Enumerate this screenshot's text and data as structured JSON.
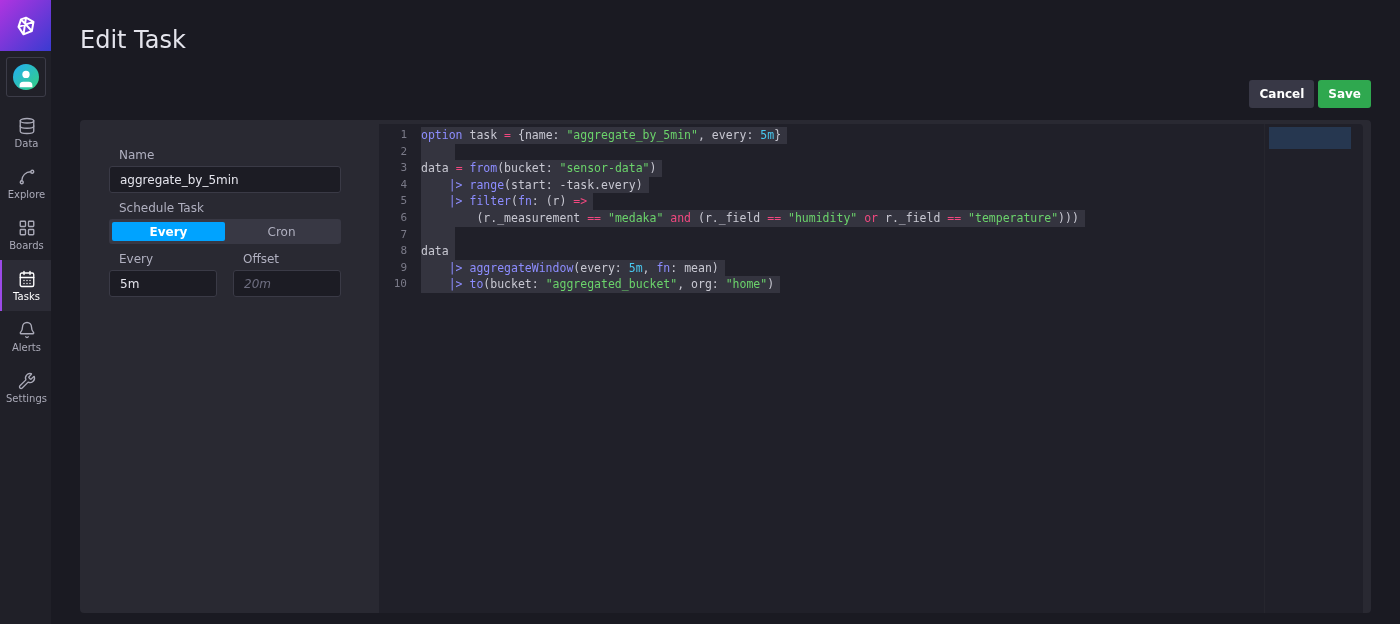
{
  "sidebar": {
    "items": [
      {
        "label": "Data",
        "selected": false
      },
      {
        "label": "Explore",
        "selected": false
      },
      {
        "label": "Boards",
        "selected": false
      },
      {
        "label": "Tasks",
        "selected": true
      },
      {
        "label": "Alerts",
        "selected": false
      },
      {
        "label": "Settings",
        "selected": false
      }
    ]
  },
  "page": {
    "title": "Edit Task"
  },
  "actions": [
    {
      "label": "Cancel",
      "kind": "secondary"
    },
    {
      "label": "Save",
      "kind": "primary"
    }
  ],
  "form": {
    "name": {
      "label": "Name",
      "value": "aggregate_by_5min"
    },
    "schedule": {
      "label": "Schedule Task",
      "options": [
        {
          "label": "Every",
          "selected": true
        },
        {
          "label": "Cron",
          "selected": false
        }
      ]
    },
    "every": {
      "label": "Every",
      "value": "5m"
    },
    "offset": {
      "label": "Offset",
      "placeholder": "20m"
    }
  },
  "editor": {
    "lines": [
      {
        "number": "1",
        "tokens": [
          {
            "kind": "kw",
            "text": "option"
          },
          {
            "kind": "text",
            "text": " task "
          },
          {
            "kind": "op",
            "text": "="
          },
          {
            "kind": "text",
            "text": " {name: "
          },
          {
            "kind": "str",
            "text": "\"aggregate_by_5min\""
          },
          {
            "kind": "text",
            "text": ", every: "
          },
          {
            "kind": "num",
            "text": "5m"
          },
          {
            "kind": "text",
            "text": "}"
          }
        ]
      },
      {
        "number": "2"
      },
      {
        "number": "3",
        "tokens": [
          {
            "kind": "text",
            "text": "data "
          },
          {
            "kind": "op",
            "text": "= "
          },
          {
            "kind": "kw",
            "text": "from"
          },
          {
            "kind": "text",
            "text": "(bucket: "
          },
          {
            "kind": "str",
            "text": "\"sensor-data\""
          },
          {
            "kind": "text",
            "text": ")"
          }
        ]
      },
      {
        "number": "4",
        "tokens": [
          {
            "kind": "kw",
            "text": "    |> range"
          },
          {
            "kind": "text",
            "text": "(start: -task.every)"
          }
        ]
      },
      {
        "number": "5",
        "tokens": [
          {
            "kind": "kw",
            "text": "    |> filter"
          },
          {
            "kind": "text",
            "text": "("
          },
          {
            "kind": "kw",
            "text": "fn"
          },
          {
            "kind": "text",
            "text": ": (r) "
          },
          {
            "kind": "op",
            "text": "=>"
          }
        ]
      },
      {
        "number": "6",
        "tokens": [
          {
            "kind": "text",
            "text": "        (r._measurement "
          },
          {
            "kind": "op",
            "text": "== "
          },
          {
            "kind": "str",
            "text": "\"medaka\" "
          },
          {
            "kind": "op",
            "text": "and"
          },
          {
            "kind": "text",
            "text": " (r._field "
          },
          {
            "kind": "op",
            "text": "== "
          },
          {
            "kind": "str",
            "text": "\"humidity\" "
          },
          {
            "kind": "op",
            "text": "or"
          },
          {
            "kind": "text",
            "text": " r._field "
          },
          {
            "kind": "op",
            "text": "== "
          },
          {
            "kind": "str",
            "text": "\"temperature\""
          },
          {
            "kind": "text",
            "text": ")))"
          }
        ]
      },
      {
        "number": "7"
      },
      {
        "number": "8",
        "tokens": [
          {
            "kind": "text",
            "text": "data"
          }
        ]
      },
      {
        "number": "9",
        "tokens": [
          {
            "kind": "kw",
            "text": "    |> aggregateWindow"
          },
          {
            "kind": "text",
            "text": "(every: "
          },
          {
            "kind": "num",
            "text": "5m"
          },
          {
            "kind": "text",
            "text": ", "
          },
          {
            "kind": "kw",
            "text": "fn"
          },
          {
            "kind": "text",
            "text": ": mean)"
          }
        ]
      },
      {
        "number": "10",
        "tokens": [
          {
            "kind": "kw",
            "text": "    |> to"
          },
          {
            "kind": "text",
            "text": "(bucket: "
          },
          {
            "kind": "str",
            "text": "\"aggregated_bucket\""
          },
          {
            "kind": "text",
            "text": ", org: "
          },
          {
            "kind": "str",
            "text": "\"home\""
          },
          {
            "kind": "text",
            "text": ")"
          }
        ]
      }
    ]
  }
}
